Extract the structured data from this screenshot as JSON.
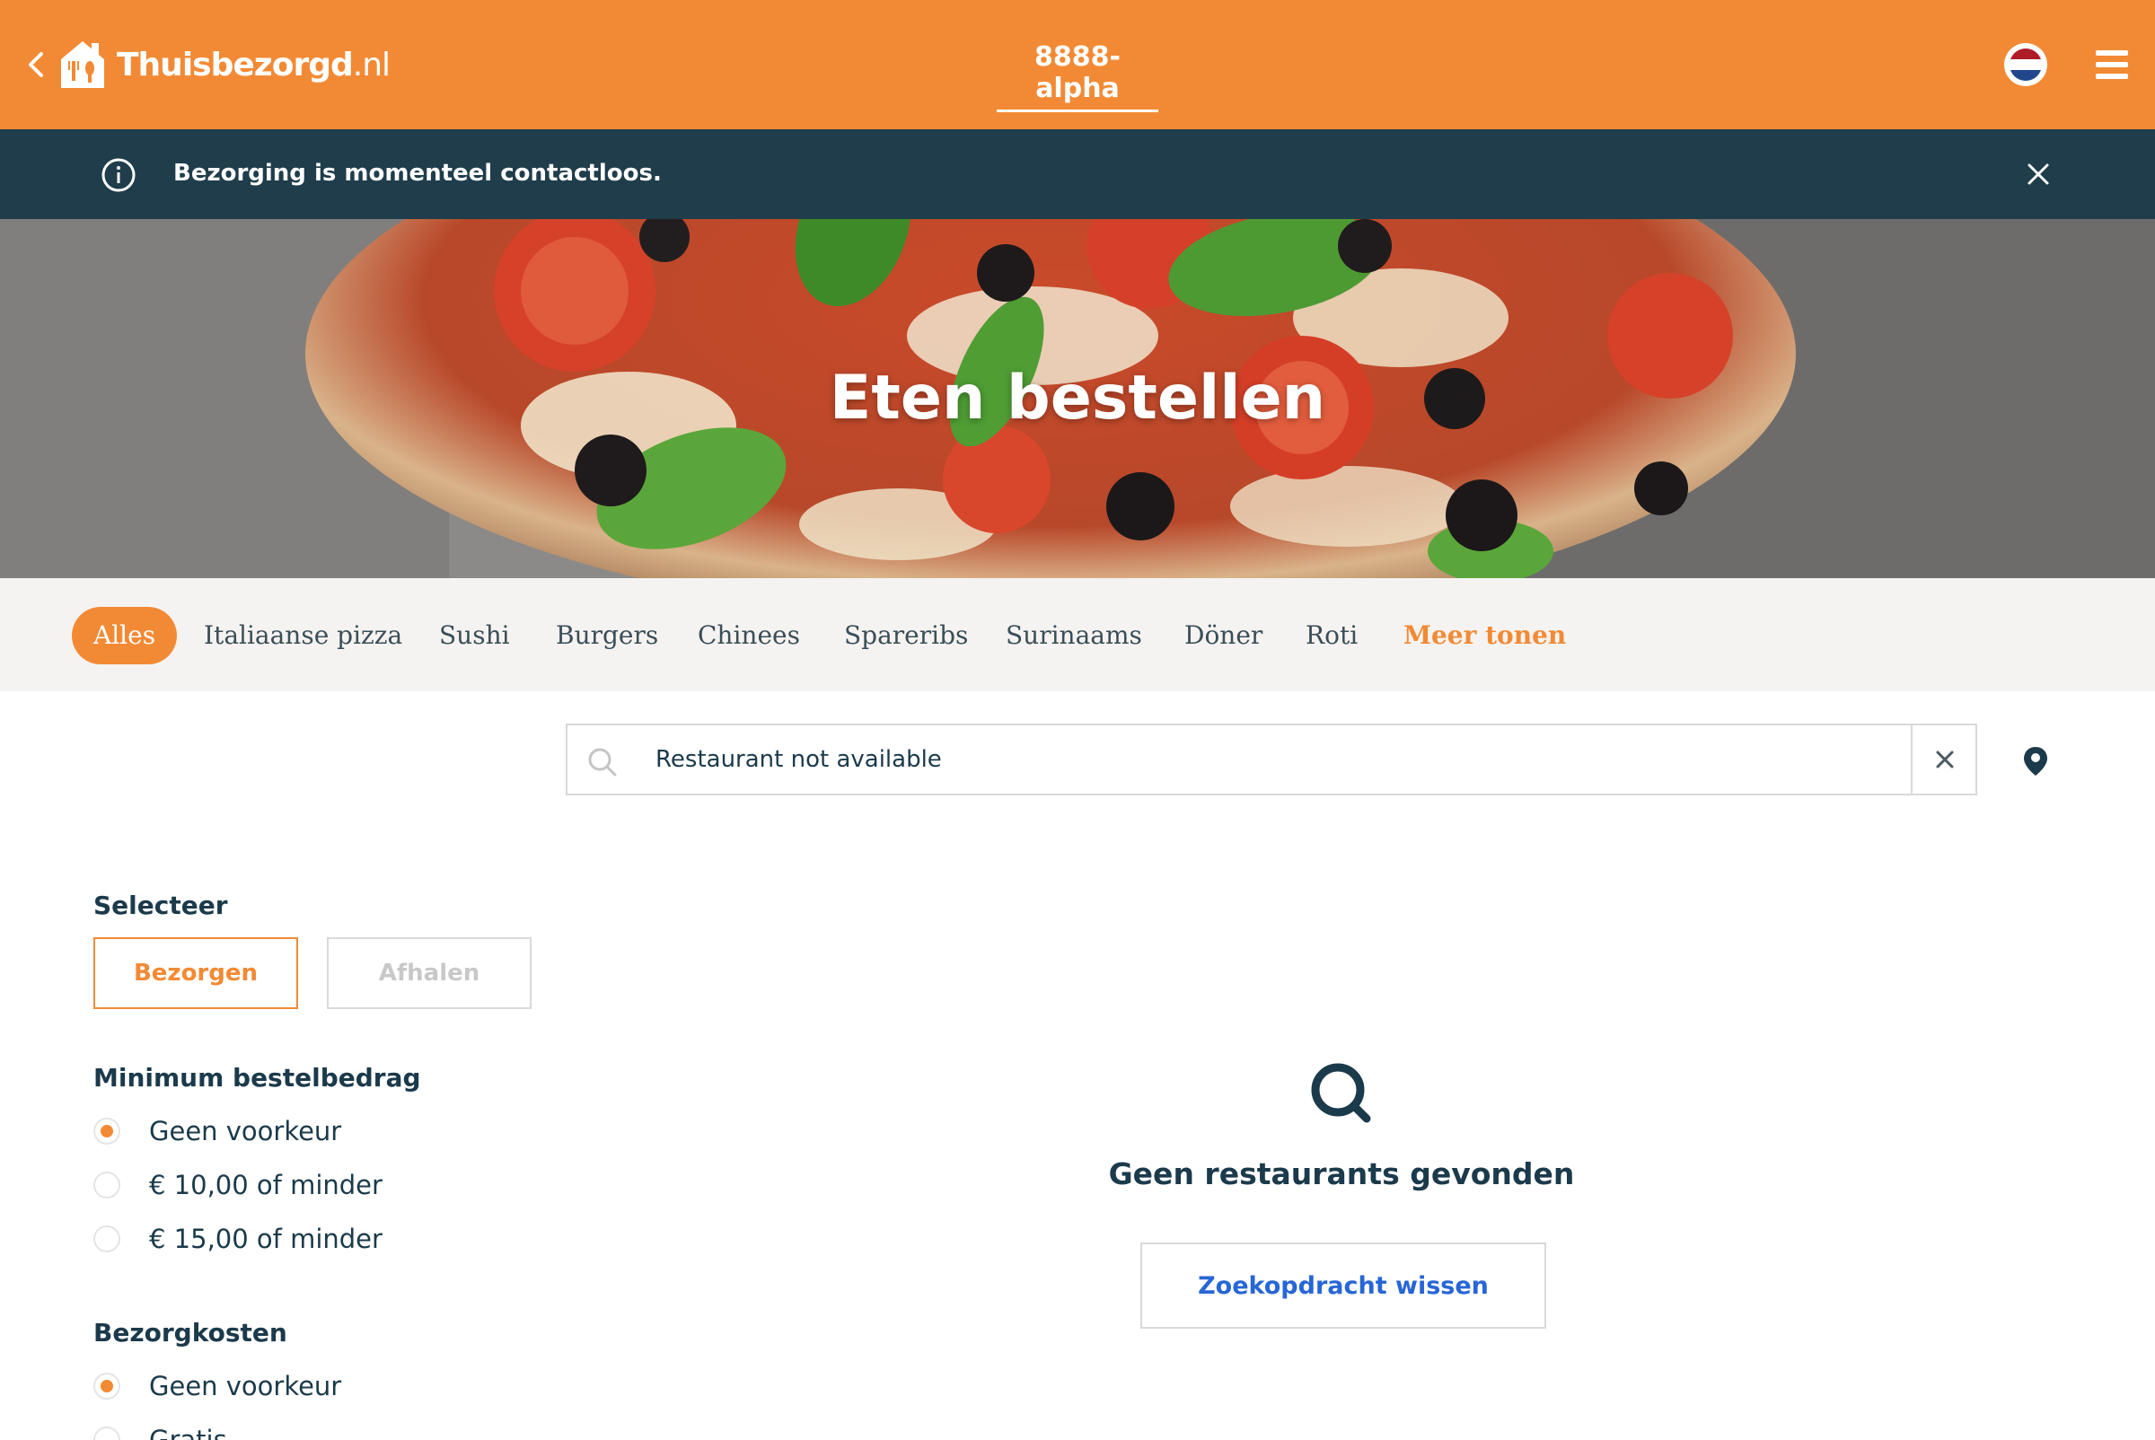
{
  "header": {
    "logo_name": "Thuisbezorgd",
    "logo_tld": ".nl",
    "title": "8888-alpha",
    "back_icon": "chevron-left-icon",
    "flag_icon": "netherlands-flag-icon",
    "menu_icon": "hamburger-menu-icon"
  },
  "info_bar": {
    "text": "Bezorging is momenteel contactloos.",
    "icon": "info-icon",
    "close_icon": "close-icon"
  },
  "hero": {
    "title": "Eten bestellen"
  },
  "categories": [
    {
      "label": "Alles",
      "active": true
    },
    {
      "label": "Italiaanse pizza"
    },
    {
      "label": "Sushi"
    },
    {
      "label": "Burgers"
    },
    {
      "label": "Chinees"
    },
    {
      "label": "Spareribs"
    },
    {
      "label": "Surinaams"
    },
    {
      "label": "Döner"
    },
    {
      "label": "Roti"
    },
    {
      "label": "Meer tonen",
      "more": true
    }
  ],
  "search": {
    "value": "Restaurant not available"
  },
  "filters": {
    "select_title": "Selecteer",
    "delivery_label": "Bezorgen",
    "pickup_label": "Afhalen",
    "min_order": {
      "title": "Minimum bestelbedrag",
      "options": [
        "Geen voorkeur",
        "€ 10,00 of minder",
        "€ 15,00 of minder"
      ],
      "selected": 0
    },
    "delivery_cost": {
      "title": "Bezorgkosten",
      "options": [
        "Geen voorkeur",
        "Gratis"
      ],
      "selected": 0
    }
  },
  "empty_state": {
    "title": "Geen restaurants gevonden",
    "button_label": "Zoekopdracht wissen"
  },
  "colors": {
    "brand_orange": "#f28a35",
    "info_bar": "#1f3d4b",
    "text_dark": "#1b3a4b",
    "link_blue": "#2766d6"
  }
}
